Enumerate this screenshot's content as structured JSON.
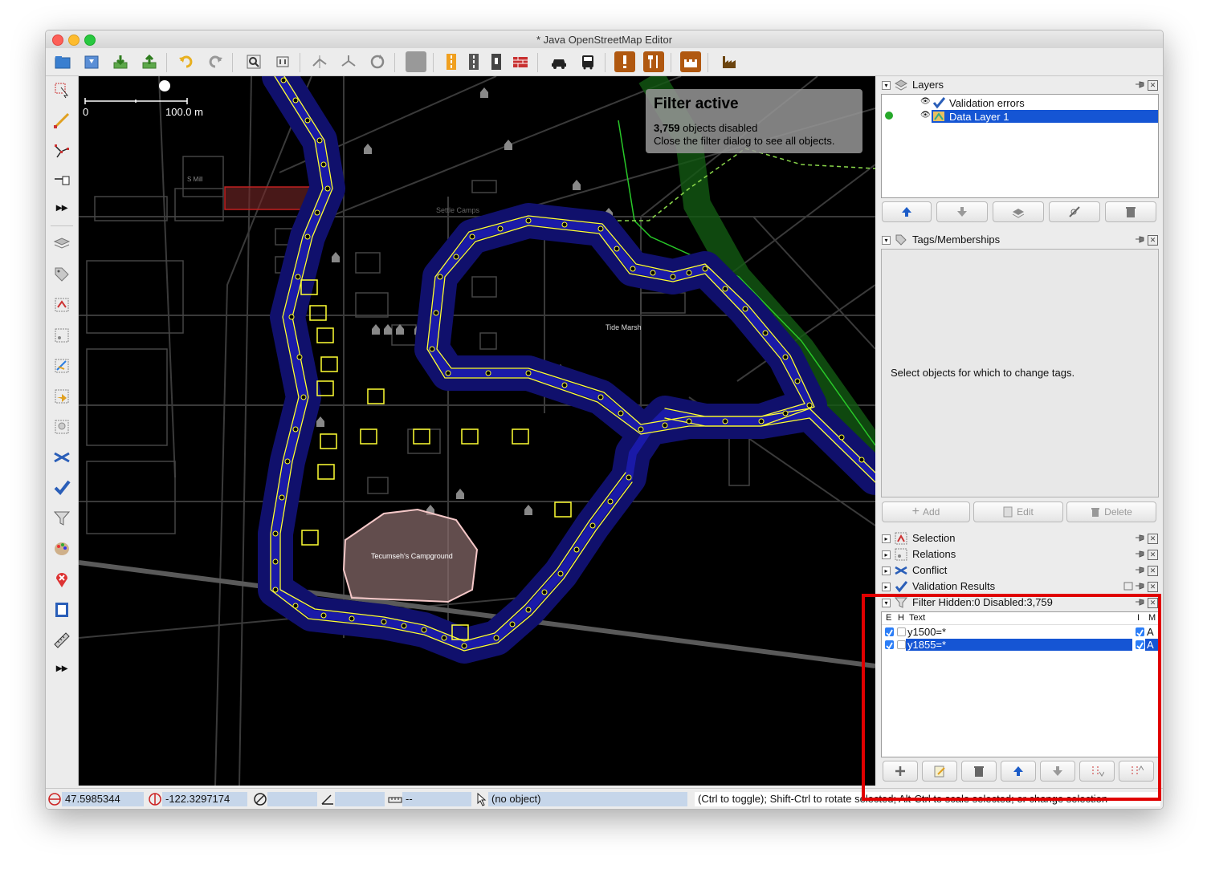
{
  "window": {
    "title": "* Java OpenStreetMap Editor"
  },
  "map": {
    "scale_start": "0",
    "scale_end": "100.0 m",
    "labels": {
      "tide_marsh": "Tide Marsh",
      "campground": "Tecumseh's Campground",
      "mill": "S Mill",
      "settlement": "Settle Camps"
    },
    "filter_overlay": {
      "heading": "Filter active",
      "count_bold": "3,759",
      "count_rest": " objects disabled",
      "hint": "Close the filter dialog to see all objects."
    }
  },
  "layers": {
    "title": "Layers",
    "items": [
      {
        "name": "Validation errors",
        "selected": false
      },
      {
        "name": "Data Layer 1",
        "selected": true
      }
    ]
  },
  "tags": {
    "title": "Tags/Memberships",
    "empty_text": "Select objects for which to change tags.",
    "add_label": "Add",
    "edit_label": "Edit",
    "delete_label": "Delete"
  },
  "collapsed_panels": {
    "selection": "Selection",
    "relations": "Relations",
    "conflict": "Conflict",
    "validation": "Validation Results"
  },
  "filter_panel": {
    "title": "Filter Hidden:0 Disabled:3,759",
    "columns": {
      "e": "E",
      "h": "H",
      "text": "Text",
      "i": "I",
      "m": "M"
    },
    "rows": [
      {
        "text": "y1500=*",
        "mode": "A",
        "selected": false
      },
      {
        "text": "y1855=*",
        "mode": "A",
        "selected": true
      }
    ]
  },
  "status": {
    "lat": "47.5985344",
    "lon": "-122.3297174",
    "dist": "--",
    "object": "(no object)",
    "help": "(Ctrl to toggle); Shift-Ctrl to rotate selected; Alt-Ctrl to scale selected; or change selection"
  },
  "colors": {
    "selection_blue": "#1555d4",
    "highlight_red": "#e00000",
    "way_yellow": "#ffff33",
    "river_blue": "#1a1a8c"
  }
}
